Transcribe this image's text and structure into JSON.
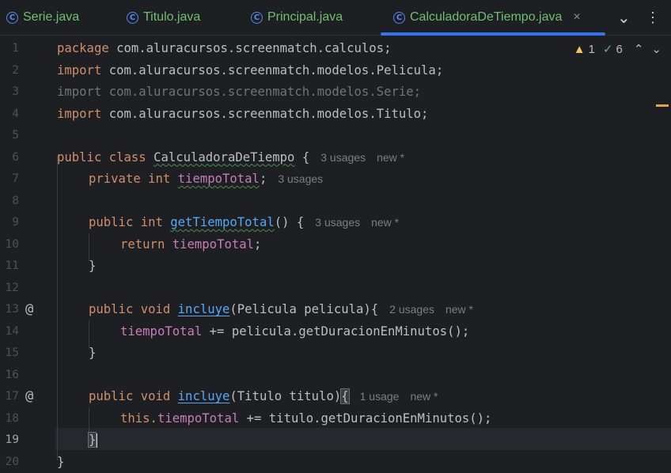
{
  "tabs": [
    {
      "label": "Serie.java",
      "icon": "class-icon",
      "active": false
    },
    {
      "label": "Titulo.java",
      "icon": "class-icon",
      "active": false
    },
    {
      "label": "Principal.java",
      "icon": "class-run-icon",
      "active": false
    },
    {
      "label": "CalculadoraDeTiempo.java",
      "icon": "class-icon",
      "active": true
    }
  ],
  "tab_icon_letter": "C",
  "tab_close": "×",
  "tab_tools": {
    "more_tabs": "⌄",
    "options": "⋮"
  },
  "inspection": {
    "warnings": "1",
    "checks": "6"
  },
  "colors": {
    "keyword": "#cf8e6d",
    "field": "#c77dbb",
    "method": "#56a8f5",
    "tab_text": "#6fbf73",
    "accent": "#3574f0"
  },
  "editor": {
    "current_line": "19",
    "lines": [
      {
        "n": "1",
        "tokens": [
          "package",
          "com.aluracursos.screenmatch.calculos;"
        ]
      },
      {
        "n": "2",
        "tokens": [
          "import",
          "com.aluracursos.screenmatch.modelos.Pelicula;"
        ]
      },
      {
        "n": "3",
        "tokens": [
          "import com.aluracursos.screenmatch.modelos.Serie;"
        ]
      },
      {
        "n": "4",
        "tokens": [
          "import",
          "com.aluracursos.screenmatch.modelos.Titulo;"
        ]
      },
      {
        "n": "5",
        "tokens": []
      },
      {
        "n": "6",
        "tokens": [
          "public class",
          "CalculadoraDeTiempo",
          "{",
          "3 usages",
          "new *"
        ]
      },
      {
        "n": "7",
        "tokens": [
          "private int",
          "tiempoTotal",
          ";",
          "3 usages"
        ]
      },
      {
        "n": "8",
        "tokens": []
      },
      {
        "n": "9",
        "tokens": [
          "public int",
          "getTiempoTotal",
          "() {",
          "3 usages",
          "new *"
        ]
      },
      {
        "n": "10",
        "tokens": [
          "return",
          "tiempoTotal",
          ";"
        ]
      },
      {
        "n": "11",
        "tokens": [
          "}"
        ]
      },
      {
        "n": "12",
        "tokens": []
      },
      {
        "n": "13",
        "gutter": "@",
        "tokens": [
          "public void",
          "incluye",
          "(Pelicula pelicula){",
          "2 usages",
          "new *"
        ]
      },
      {
        "n": "14",
        "tokens": [
          "tiempoTotal",
          " += pelicula.getDuracionEnMinutos();"
        ]
      },
      {
        "n": "15",
        "tokens": [
          "}"
        ]
      },
      {
        "n": "16",
        "tokens": []
      },
      {
        "n": "17",
        "gutter": "@",
        "tokens": [
          "public void",
          "incluye",
          "(Titulo titulo)",
          "{",
          "1 usage",
          "new *"
        ]
      },
      {
        "n": "18",
        "tokens": [
          "this.",
          "tiempoTotal",
          " += titulo.getDuracionEnMinutos();"
        ]
      },
      {
        "n": "19",
        "tokens": [
          "}"
        ]
      },
      {
        "n": "20",
        "tokens": [
          "}"
        ]
      }
    ]
  }
}
